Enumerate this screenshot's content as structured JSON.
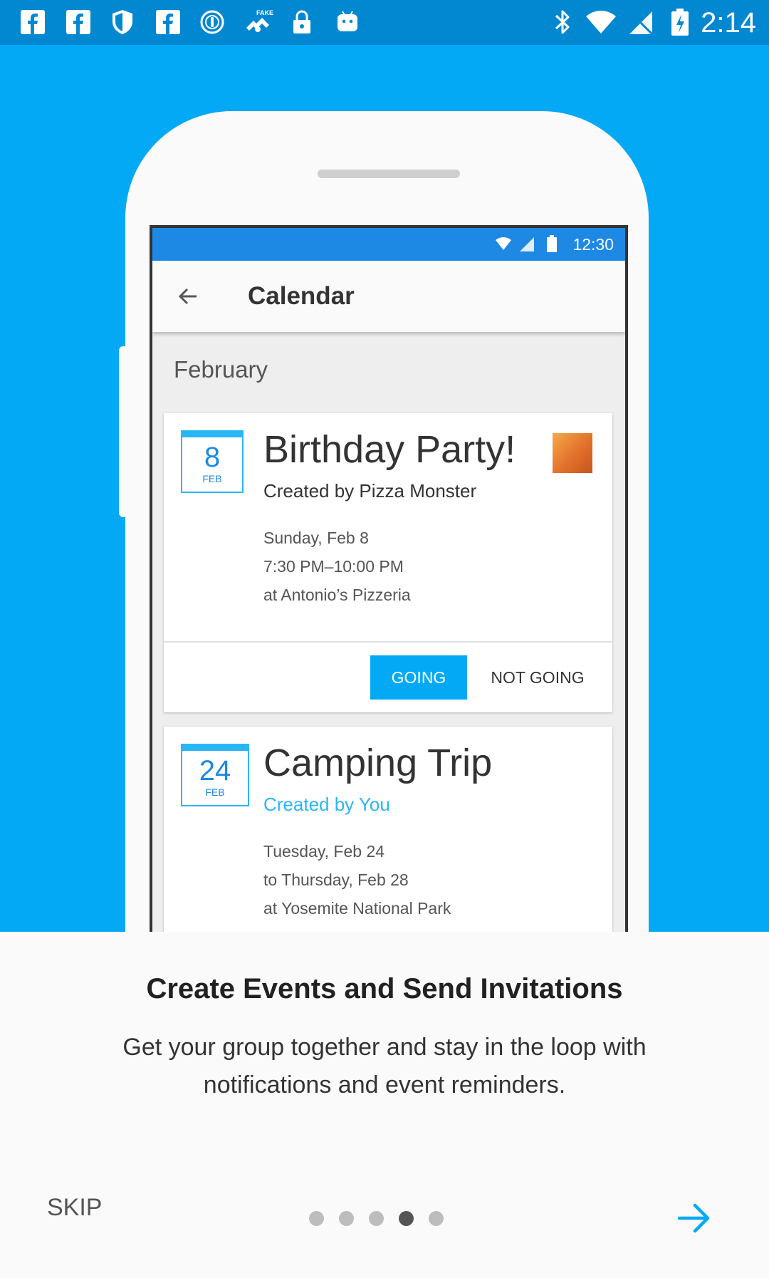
{
  "status_bar": {
    "time": "2:14",
    "left_icons": [
      "facebook-icon",
      "facebook-icon",
      "shield-icon",
      "facebook-icon",
      "password-manager-icon",
      "fake-gps-icon",
      "lock-icon",
      "android-icon"
    ],
    "right_icons": [
      "bluetooth-icon",
      "wifi-icon",
      "no-signal-icon",
      "battery-charging-icon"
    ]
  },
  "illustration": {
    "status_time": "12:30",
    "app_title": "Calendar",
    "month": "February",
    "events": [
      {
        "day": "8",
        "month": "FEB",
        "title": "Birthday Party!",
        "creator": "Created by Pizza Monster",
        "details": [
          "Sunday, Feb 8",
          "7:30 PM–10:00 PM",
          "at Antonio’s Pizzeria"
        ],
        "going_label": "GOING",
        "not_going_label": "NOT GOING"
      },
      {
        "day": "24",
        "month": "FEB",
        "title": "Camping Trip",
        "creator": "Created by You",
        "details": [
          "Tuesday, Feb 24",
          "to Thursday, Feb 28",
          "at Yosemite National Park"
        ]
      }
    ]
  },
  "onboarding": {
    "title": "Create Events and Send Invitations",
    "description": "Get your group together and stay in the loop with notifications and event reminders.",
    "skip_label": "SKIP",
    "page_count": 5,
    "current_page": 4
  },
  "colors": {
    "accent": "#03A9F4",
    "status_bar": "#0288D1",
    "panel_bg": "#FAFAFA"
  }
}
